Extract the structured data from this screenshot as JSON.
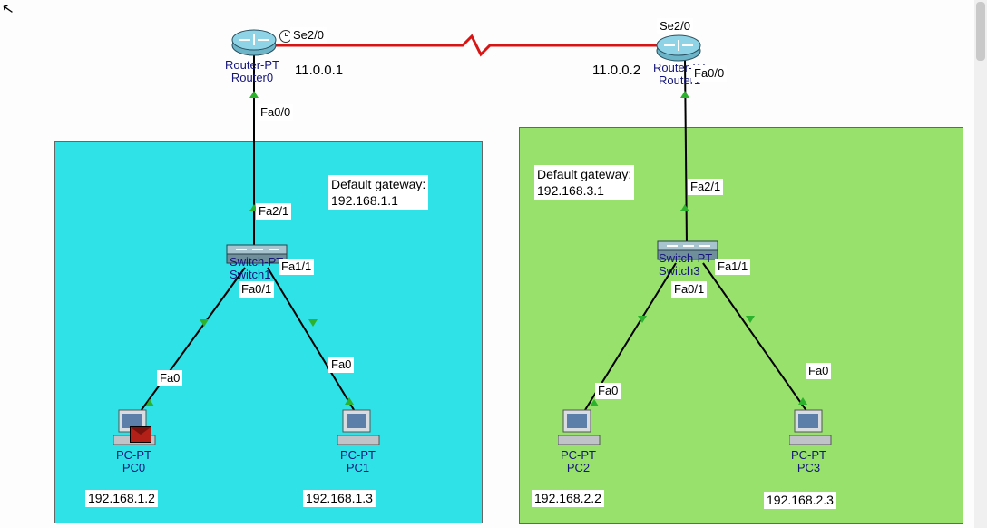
{
  "routers": {
    "r0": {
      "type": "Router-PT",
      "name": "Router0",
      "ports": {
        "serial": "Se2/0",
        "lan": "Fa0/0"
      },
      "wan_ip": "11.0.0.1"
    },
    "r1": {
      "type": "Router-PT",
      "name": "Router1",
      "ports": {
        "serial": "Se2/0",
        "lan": "Fa0/0"
      },
      "wan_ip": "11.0.0.2"
    }
  },
  "switches": {
    "s1": {
      "type": "Switch-PT",
      "name": "Switch1",
      "ports": {
        "uplink": "Fa2/1",
        "p1": "Fa0/1",
        "p2": "Fa1/1"
      }
    },
    "s3": {
      "type": "Switch-PT",
      "name": "Switch3",
      "ports": {
        "uplink": "Fa2/1",
        "p1": "Fa0/1",
        "p2": "Fa1/1"
      }
    }
  },
  "pcs": {
    "pc0": {
      "type": "PC-PT",
      "name": "PC0",
      "port": "Fa0",
      "ip": "192.168.1.2"
    },
    "pc1": {
      "type": "PC-PT",
      "name": "PC1",
      "port": "Fa0",
      "ip": "192.168.1.3"
    },
    "pc2": {
      "type": "PC-PT",
      "name": "PC2",
      "port": "Fa0",
      "ip": "192.168.2.2"
    },
    "pc3": {
      "type": "PC-PT",
      "name": "PC3",
      "port": "Fa0",
      "ip": "192.168.2.3"
    }
  },
  "gateways": {
    "left": {
      "label": "Default gateway:",
      "ip": "192.168.1.1"
    },
    "right": {
      "label": "Default gateway:",
      "ip": "192.168.3.1"
    }
  }
}
